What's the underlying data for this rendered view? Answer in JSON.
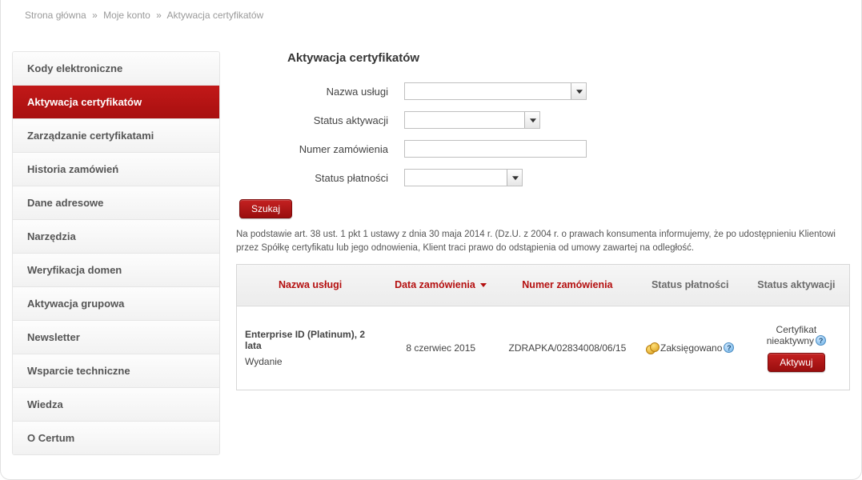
{
  "breadcrumb": {
    "home": "Strona główna",
    "account": "Moje konto",
    "current": "Aktywacja certyfikatów",
    "sep": "»"
  },
  "sidebar": {
    "items": [
      {
        "label": "Kody elektroniczne",
        "active": false
      },
      {
        "label": "Aktywacja certyfikatów",
        "active": true
      },
      {
        "label": "Zarządzanie certyfikatami",
        "active": false
      },
      {
        "label": "Historia zamówień",
        "active": false
      },
      {
        "label": "Dane adresowe",
        "active": false
      },
      {
        "label": "Narzędzia",
        "active": false
      },
      {
        "label": "Weryfikacja domen",
        "active": false
      },
      {
        "label": "Aktywacja grupowa",
        "active": false
      },
      {
        "label": "Newsletter",
        "active": false
      },
      {
        "label": "Wsparcie techniczne",
        "active": false
      },
      {
        "label": "Wiedza",
        "active": false
      },
      {
        "label": "O Certum",
        "active": false
      }
    ]
  },
  "main": {
    "title": "Aktywacja certyfikatów",
    "filters": {
      "service_label": "Nazwa usługi",
      "activation_status_label": "Status aktywacji",
      "order_number_label": "Numer zamówienia",
      "payment_status_label": "Status płatności"
    },
    "search_button": "Szukaj",
    "legal_note": "Na podstawie art. 38 ust. 1 pkt 1 ustawy z dnia 30 maja 2014 r. (Dz.U. z 2004 r. o prawach konsumenta informujemy, że po udostępnieniu Klientowi przez Spółkę certyfikatu lub jego odnowienia, Klient traci prawo do odstąpienia od umowy zawartej na odległość.",
    "table": {
      "headers": {
        "service": "Nazwa usługi",
        "order_date": "Data zamówienia",
        "order_number": "Numer zamówienia",
        "payment_status": "Status płatności",
        "activation_status": "Status aktywacji"
      },
      "rows": [
        {
          "service_name": "Enterprise ID (Platinum), 2 lata",
          "service_sub": "Wydanie",
          "order_date": "8 czerwiec 2015",
          "order_number": "ZDRAPKA/02834008/06/15",
          "payment_status": "Zaksięgowano",
          "activation_status": "Certyfikat nieaktywny",
          "activate_label": "Aktywuj"
        }
      ]
    }
  }
}
